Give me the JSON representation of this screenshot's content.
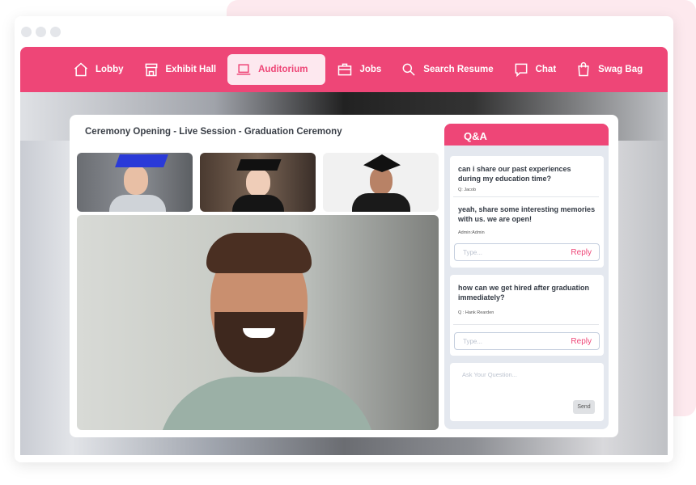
{
  "nav": {
    "items": [
      {
        "label": "Lobby",
        "icon": "home-icon"
      },
      {
        "label": "Exhibit Hall",
        "icon": "store-icon"
      },
      {
        "label": "Auditorium",
        "icon": "laptop-icon",
        "active": true
      },
      {
        "label": "Jobs",
        "icon": "briefcase-icon"
      },
      {
        "label": "Search Resume",
        "icon": "search-icon"
      },
      {
        "label": "Chat",
        "icon": "chat-icon"
      },
      {
        "label": "Swag Bag",
        "icon": "bag-icon"
      }
    ]
  },
  "session": {
    "title": "Ceremony Opening - Live Session - Graduation Ceremony"
  },
  "qa": {
    "title": "Q&A",
    "threads": [
      {
        "question": "can i share our past experiences during my education time?",
        "asker": "Q: Jacob",
        "answer": "yeah, share some interesting memories with us. we are open!",
        "answerer": "Admin:Admin",
        "reply_placeholder": "Type...",
        "reply_label": "Reply"
      },
      {
        "question": "how can we get hired after graduation immediately?",
        "asker": "Q : Hank Rearden",
        "reply_placeholder": "Type...",
        "reply_label": "Reply"
      }
    ],
    "ask_placeholder": "Ask Your Question...",
    "send_label": "Send"
  },
  "colors": {
    "accent": "#ee4677",
    "panel": "#e4e8ef"
  }
}
